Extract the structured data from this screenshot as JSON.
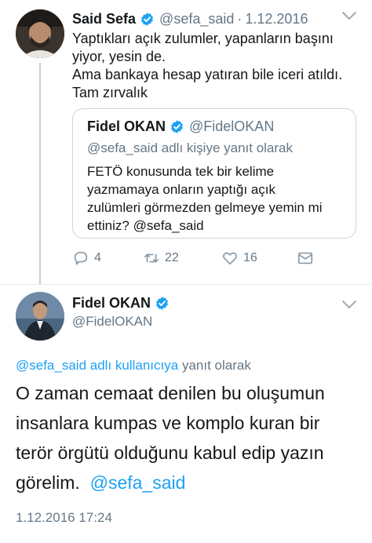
{
  "tweet": {
    "author_name": "Said Sefa",
    "author_handle": "@sefa_said",
    "separator": "·",
    "date": "1.12.2016",
    "lines": [
      "Yaptıkları açık zulumler, yapanların başını",
      "yiyor, yesin de.",
      "Ama bankaya hesap yatıran bile iceri atıldı.",
      "Tam zırvalık"
    ],
    "quote": {
      "author_name": "Fidel OKAN",
      "author_handle": "@FidelOKAN",
      "reply_context": "@sefa_said adlı kişiye yanıt olarak",
      "lines": [
        "FETÖ konusunda tek bir kelime",
        "yazmamaya onların yaptığı açık",
        "zulümleri görmezden gelmeye yemin mi",
        "ettiniz? @sefa_said"
      ]
    },
    "actions": {
      "reply_count": "4",
      "retweet_count": "22",
      "like_count": "16",
      "reply_icon": "reply-bubble-icon",
      "retweet_icon": "retweet-icon",
      "like_icon": "heart-icon",
      "message_icon": "envelope-icon"
    }
  },
  "reply": {
    "author_name": "Fidel OKAN",
    "author_handle": "@FidelOKAN",
    "reply_mention": "@sefa_said adlı kullanıcıya",
    "reply_suffix": "yanıt olarak",
    "lines": [
      "O zaman cemaat denilen bu oluşumun",
      "insanlara kumpas ve komplo kuran bir",
      "terör örgütü olduğunu kabul edip yazın",
      "görelim."
    ],
    "trailing_mention": "@sefa_said",
    "timestamp": "1.12.2016 17:24"
  },
  "colors": {
    "accent": "#1da1f2",
    "secondary_text": "#657786",
    "border": "#ccd6dd"
  }
}
